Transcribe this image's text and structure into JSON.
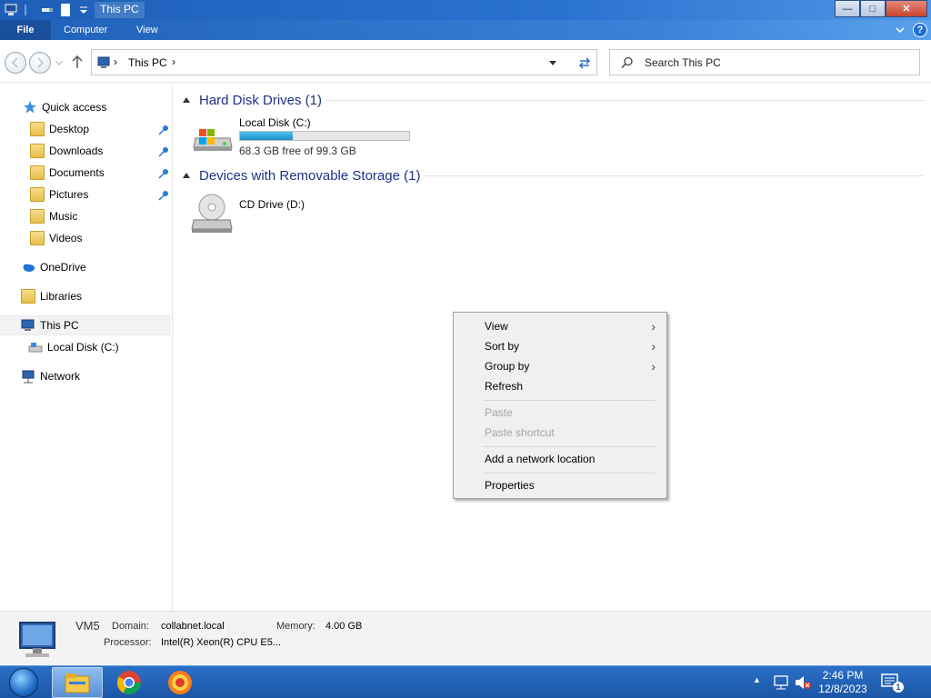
{
  "window": {
    "title": "This PC",
    "minimize_glyph": "—",
    "maximize_glyph": "□",
    "close_glyph": "✕"
  },
  "ribbon": {
    "tabs": [
      {
        "label": "File"
      },
      {
        "label": "Computer"
      },
      {
        "label": "View"
      }
    ],
    "help_glyph": "?"
  },
  "address_bar": {
    "path": "This PC",
    "breadcrumb_separator": "›"
  },
  "search": {
    "placeholder": "Search This PC"
  },
  "nav_pane": {
    "quick_access": "Quick access",
    "quick_items": [
      {
        "label": "Desktop",
        "pinned": true
      },
      {
        "label": "Downloads",
        "pinned": true
      },
      {
        "label": "Documents",
        "pinned": true
      },
      {
        "label": "Pictures",
        "pinned": true
      },
      {
        "label": "Music",
        "pinned": false
      },
      {
        "label": "Videos",
        "pinned": false
      }
    ],
    "onedrive": "OneDrive",
    "libraries": "Libraries",
    "this_pc": "This PC",
    "local_disk": "Local Disk (C:)",
    "network": "Network"
  },
  "content": {
    "groups": [
      {
        "label": "Hard Disk Drives (1)"
      },
      {
        "label": "Devices with Removable Storage (1)"
      }
    ],
    "local_disk": {
      "name": "Local Disk (C:)",
      "space_text": "68.3 GB free of 99.3 GB",
      "used_fraction": 0.312
    },
    "cd_drive": {
      "name": "CD Drive (D:)"
    }
  },
  "context_menu": {
    "items": [
      {
        "label": "View",
        "submenu": true,
        "enabled": true
      },
      {
        "label": "Sort by",
        "submenu": true,
        "enabled": true
      },
      {
        "label": "Group by",
        "submenu": true,
        "enabled": true
      },
      {
        "label": "Refresh",
        "submenu": false,
        "enabled": true
      },
      {
        "label": "Paste",
        "submenu": false,
        "enabled": false
      },
      {
        "label": "Paste shortcut",
        "submenu": false,
        "enabled": false
      },
      {
        "label": "Add a network location",
        "submenu": false,
        "enabled": true
      },
      {
        "label": "Properties",
        "submenu": false,
        "enabled": true
      }
    ],
    "submenu_arrow": "›"
  },
  "details": {
    "name": "VM5",
    "domain_label": "Domain:",
    "domain_value": "collabnet.local",
    "memory_label": "Memory:",
    "memory_value": "4.00 GB",
    "processor_label": "Processor:",
    "processor_value": "Intel(R) Xeon(R) CPU E5..."
  },
  "taskbar": {
    "time": "2:46 PM",
    "date": "12/8/2023",
    "notification_count": "1",
    "tray_up_glyph": "▲"
  },
  "colors": {
    "titlebar": "#2a72d0",
    "group_header": "#1e3287",
    "progress": "#26a0da",
    "taskbar": "#1c56a6"
  }
}
